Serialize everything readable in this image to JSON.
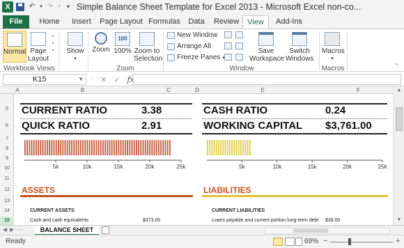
{
  "window": {
    "title": "Simple Balance Sheet Template for Excel 2013 - Microsoft Excel non-co...",
    "app_icon": "excel-icon"
  },
  "ribbon_tabs": [
    "File",
    "Home",
    "Insert",
    "Page Layout",
    "Formulas",
    "Data",
    "Review",
    "View",
    "Add-Ins"
  ],
  "active_tab": "View",
  "ribbon": {
    "normal": "Normal",
    "page_layout": "Page\nLayout",
    "show": "Show",
    "zoom": "Zoom",
    "zoom100": "100%",
    "zoom_to_selection": "Zoom to\nSelection",
    "new_window": "New Window",
    "arrange_all": "Arrange All",
    "freeze_panes": "Freeze Panes",
    "save_workspace": "Save\nWorkspace",
    "switch_windows": "Switch\nWindows",
    "macros": "Macros",
    "groups": {
      "workbook_views": "Workbook Views",
      "zoom": "Zoom",
      "window": "Window",
      "macros": "Macros"
    }
  },
  "formula_bar": {
    "name_box": "K15",
    "fx": "fx",
    "cancel": "✕",
    "enter": "✓",
    "formula": ""
  },
  "columns": [
    "A",
    "B",
    "C",
    "D",
    "E",
    "F"
  ],
  "rows": [
    "5",
    "6",
    "7",
    "8",
    "9",
    "10",
    "11",
    "12",
    "13",
    "14",
    "15"
  ],
  "active_row": "15",
  "ratios": {
    "current_ratio_label": "CURRENT RATIO",
    "current_ratio_value": "3.38",
    "quick_ratio_label": "QUICK RATIO",
    "quick_ratio_value": "2.91",
    "cash_ratio_label": "CASH RATIO",
    "cash_ratio_value": "0.24",
    "working_capital_label": "WORKING CAPITAL",
    "working_capital_value": "$3,761.00"
  },
  "chart_data": [
    {
      "type": "bar",
      "orientation": "horizontal",
      "values": [
        23300
      ],
      "xlim": [
        0,
        25000
      ],
      "x_tick_labels": [
        "5k",
        "10k",
        "15k",
        "20k",
        "25k"
      ],
      "colors": [
        "#c55a3c"
      ]
    },
    {
      "type": "bar",
      "orientation": "horizontal",
      "values": [
        6300
      ],
      "xlim": [
        0,
        25000
      ],
      "x_tick_labels": [
        "5k",
        "10k",
        "15k",
        "20k",
        "25k"
      ],
      "colors": [
        "#e0cd4a"
      ]
    }
  ],
  "sections": {
    "assets": "ASSETS",
    "liabilities": "LIABILITIES",
    "current_assets": "CURRENT ASSETS",
    "current_liabilities": "CURRENT LIABILITIES",
    "cash_label": "Cash and cash equivalents",
    "cash_value": "$373.00",
    "loans_label": "Loans payable and current portion long-term debt",
    "loans_value": "$38.00"
  },
  "sheet_tab": "BALANCE SHEET",
  "status": {
    "ready": "Ready",
    "zoom": "69%",
    "minus": "−",
    "plus": "+"
  },
  "colors": {
    "excel_green": "#1e7145",
    "assets_accent": "#c4511f",
    "liabilities_accent": "#e0c23a"
  }
}
